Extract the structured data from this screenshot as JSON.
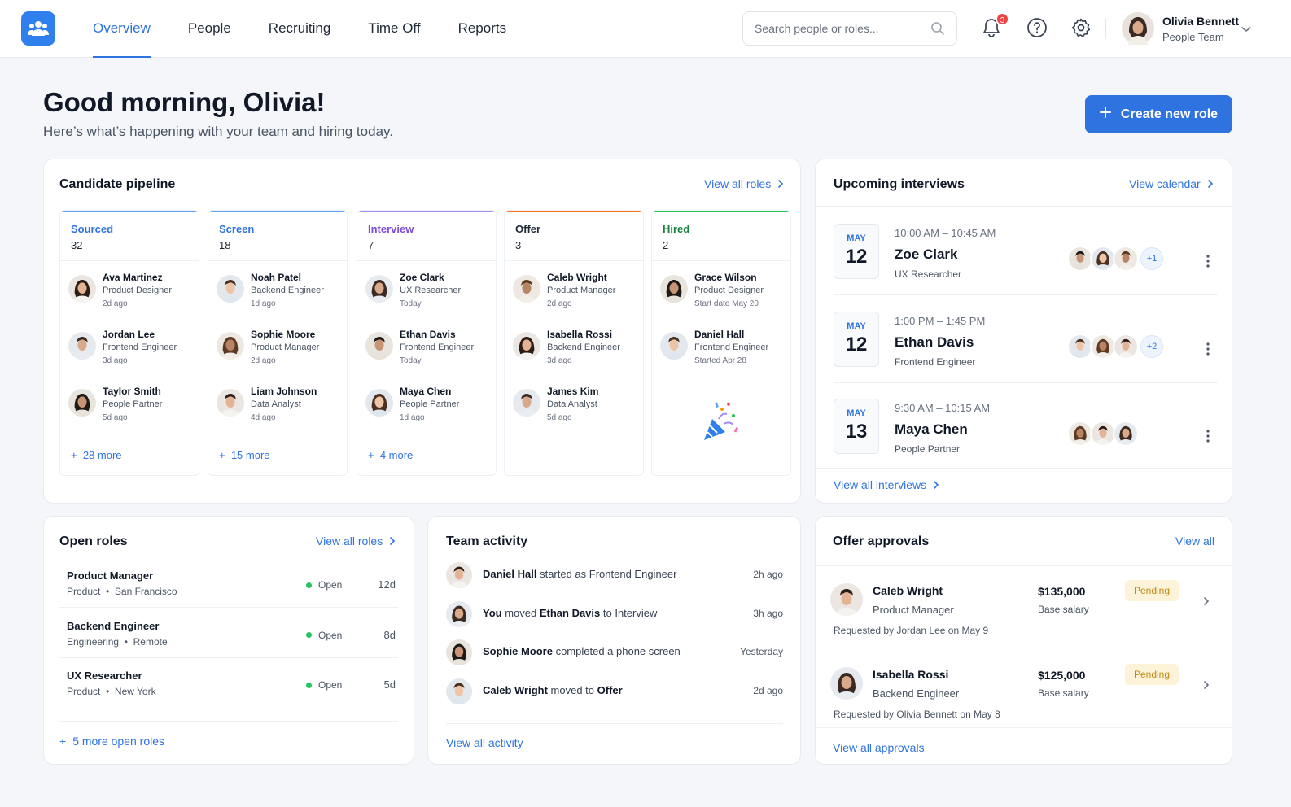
{
  "nav": {
    "items": [
      "Overview",
      "People",
      "Recruiting",
      "Time Off",
      "Reports"
    ],
    "active": "Overview"
  },
  "search": {
    "placeholder": "Search people or roles..."
  },
  "notifications": {
    "count": "3"
  },
  "user": {
    "name": "Olivia Bennett",
    "team": "People Team"
  },
  "header": {
    "greeting": "Good morning, Olivia!",
    "subtitle": "Here’s what’s happening with your team and hiring today.",
    "create_button": "Create new role"
  },
  "pipeline": {
    "title": "Candidate pipeline",
    "link": "View all roles",
    "stages": [
      {
        "name": "Sourced",
        "count": "32",
        "color": "#2f73e0",
        "more": "28 more",
        "candidates": [
          {
            "name": "Ava Martinez",
            "role": "Product Designer",
            "time": "2d ago"
          },
          {
            "name": "Jordan Lee",
            "role": "Frontend Engineer",
            "time": "3d ago"
          },
          {
            "name": "Taylor Smith",
            "role": "People Partner",
            "time": "5d ago"
          }
        ]
      },
      {
        "name": "Screen",
        "count": "18",
        "color": "#2f73e0",
        "more": "15 more",
        "candidates": [
          {
            "name": "Noah Patel",
            "role": "Backend Engineer",
            "time": "1d ago"
          },
          {
            "name": "Sophie Moore",
            "role": "Product Manager",
            "time": "2d ago"
          },
          {
            "name": "Liam Johnson",
            "role": "Data Analyst",
            "time": "4d ago"
          }
        ]
      },
      {
        "name": "Interview",
        "count": "7",
        "color": "#7c4ddb",
        "more": "4 more",
        "candidates": [
          {
            "name": "Zoe Clark",
            "role": "UX Researcher",
            "time": "Today"
          },
          {
            "name": "Ethan Davis",
            "role": "Frontend Engineer",
            "time": "Today"
          },
          {
            "name": "Maya Chen",
            "role": "People Partner",
            "time": "1d ago"
          }
        ]
      },
      {
        "name": "Offer",
        "count": "3",
        "color": "#1f2937",
        "accent": "#f97316",
        "more": "",
        "candidates": [
          {
            "name": "Caleb Wright",
            "role": "Product Manager",
            "time": "2d ago"
          },
          {
            "name": "Isabella Rossi",
            "role": "Backend Engineer",
            "time": "3d ago"
          },
          {
            "name": "James Kim",
            "role": "Data Analyst",
            "time": "5d ago"
          }
        ]
      },
      {
        "name": "Hired",
        "count": "2",
        "color": "#16803c",
        "accent": "#22c55e",
        "more": "",
        "candidates": [
          {
            "name": "Grace Wilson",
            "role": "Product Designer",
            "time": "Start date May 20"
          },
          {
            "name": "Daniel Hall",
            "role": "Frontend Engineer",
            "time": "Started Apr 28"
          }
        ]
      }
    ]
  },
  "interviews": {
    "title": "Upcoming interviews",
    "link": "View calendar",
    "footer": "View all interviews",
    "items": [
      {
        "month": "MAY",
        "day": "12",
        "time": "10:00 AM – 10:45 AM",
        "name": "Zoe Clark",
        "role": "UX Researcher",
        "extra": "+1"
      },
      {
        "month": "MAY",
        "day": "12",
        "time": "1:00 PM – 1:45 PM",
        "name": "Ethan Davis",
        "role": "Frontend Engineer",
        "extra": "+2"
      },
      {
        "month": "MAY",
        "day": "13",
        "time": "9:30 AM – 10:15 AM",
        "name": "Maya Chen",
        "role": "People Partner",
        "extra": ""
      }
    ]
  },
  "open_roles": {
    "title": "Open roles",
    "link": "View all roles",
    "footer": "5 more open roles",
    "items": [
      {
        "title": "Product Manager",
        "dept": "Product",
        "location": "San Francisco",
        "status": "Open",
        "age": "12d"
      },
      {
        "title": "Backend Engineer",
        "dept": "Engineering",
        "location": "Remote",
        "status": "Open",
        "age": "8d"
      },
      {
        "title": "UX Researcher",
        "dept": "Product",
        "location": "New York",
        "status": "Open",
        "age": "5d"
      }
    ]
  },
  "activity": {
    "title": "Team activity",
    "footer": "View all activity",
    "items": [
      {
        "actor": "Daniel Hall",
        "verb": " started as Frontend Engineer",
        "object": "",
        "time": "2h ago"
      },
      {
        "actor": "You",
        "verb": " moved ",
        "object": "Ethan Davis",
        "tail": " to Interview",
        "time": "3h ago"
      },
      {
        "actor": "Sophie Moore",
        "verb": " completed a phone screen",
        "object": "",
        "time": "Yesterday"
      },
      {
        "actor": "Caleb Wright",
        "verb": " moved to ",
        "object": "Offer",
        "time": "2d ago"
      }
    ]
  },
  "offers": {
    "title": "Offer approvals",
    "link": "View all",
    "footer": "View all approvals",
    "items": [
      {
        "name": "Caleb Wright",
        "role": "Product Manager",
        "amount": "$135,000",
        "basis": "Base salary",
        "status": "Pending",
        "requested": "Requested by Jordan Lee on May 9"
      },
      {
        "name": "Isabella Rossi",
        "role": "Backend Engineer",
        "amount": "$125,000",
        "basis": "Base salary",
        "status": "Pending",
        "requested": "Requested by Olivia Bennett on May 8"
      }
    ]
  },
  "icons": {
    "logo": "team-icon",
    "search": "search-icon",
    "bell": "bell-icon",
    "help": "help-icon",
    "settings": "gear-icon",
    "chevron": "chevron-down-icon",
    "plus": "plus-icon",
    "kebab": "kebab-icon",
    "celebration": "party-popper-icon"
  },
  "colors": {
    "accent": "#2f73e0",
    "pending_bg": "#fdf3d8",
    "pending_text": "#c08a12",
    "status_open": "#22c55e",
    "badge": "#ef4444"
  }
}
